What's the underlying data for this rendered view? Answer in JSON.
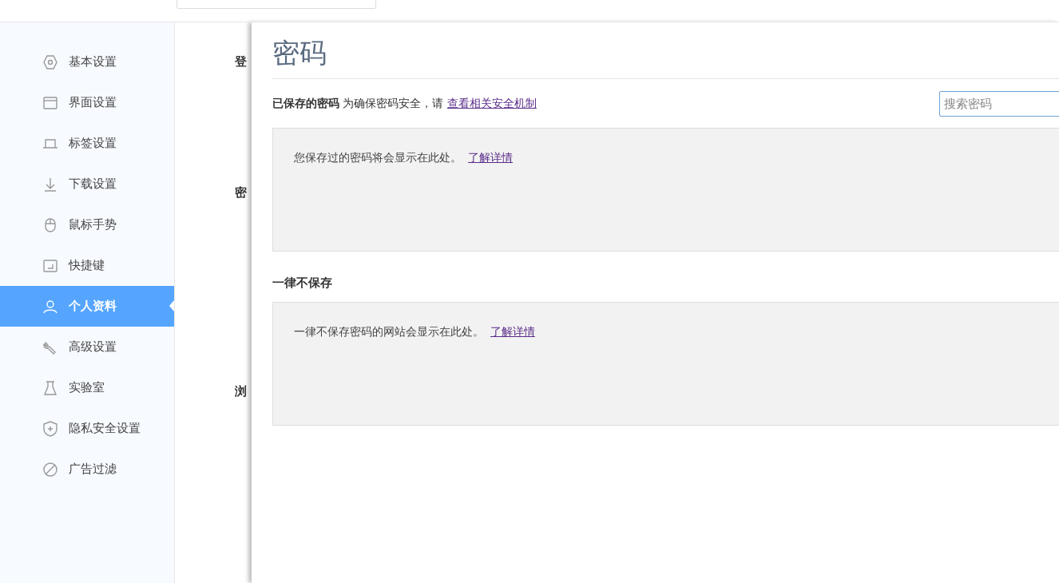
{
  "sidebar": {
    "items": [
      {
        "label": "基本设置",
        "selected": false
      },
      {
        "label": "界面设置",
        "selected": false
      },
      {
        "label": "标签设置",
        "selected": false
      },
      {
        "label": "下载设置",
        "selected": false
      },
      {
        "label": "鼠标手势",
        "selected": false
      },
      {
        "label": "快捷键",
        "selected": false
      },
      {
        "label": "个人资料",
        "selected": true
      },
      {
        "label": "高级设置",
        "selected": false
      },
      {
        "label": "实验室",
        "selected": false
      },
      {
        "label": "隐私安全设置",
        "selected": false
      },
      {
        "label": "广告过滤",
        "selected": false
      }
    ]
  },
  "background_headings": [
    "登",
    "密",
    "浏"
  ],
  "password_panel": {
    "title": "密码",
    "saved": {
      "heading": "已保存的密码",
      "note": "为确保密码安全，请",
      "link": "查看相关安全机制",
      "search": {
        "placeholder": "搜索密码"
      },
      "empty_text": "您保存过的密码将会显示在此处。",
      "empty_link": "了解详情"
    },
    "never": {
      "heading": "一律不保存",
      "empty_text": "一律不保存密码的网站会显示在此处。",
      "empty_link": "了解详情"
    }
  }
}
